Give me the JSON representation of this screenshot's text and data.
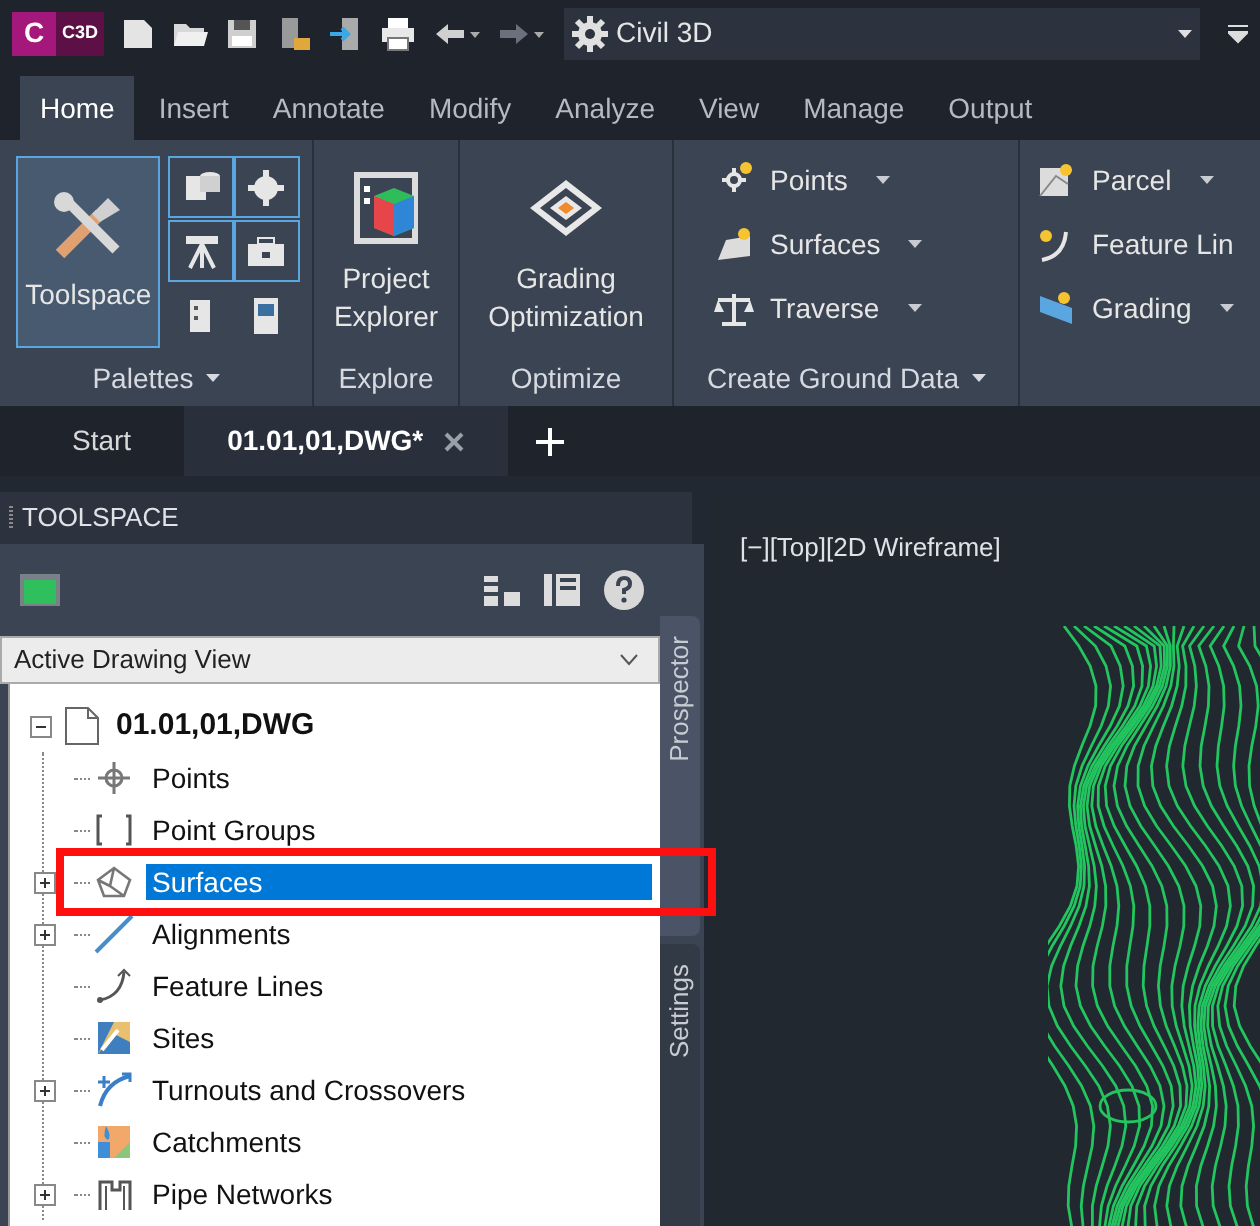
{
  "app": {
    "logo_letter": "C",
    "badge": "C3D",
    "workspace": "Civil 3D"
  },
  "ribbon_tabs": [
    {
      "label": "Home",
      "selected": true
    },
    {
      "label": "Insert",
      "selected": false
    },
    {
      "label": "Annotate",
      "selected": false
    },
    {
      "label": "Modify",
      "selected": false
    },
    {
      "label": "Analyze",
      "selected": false
    },
    {
      "label": "View",
      "selected": false
    },
    {
      "label": "Manage",
      "selected": false
    },
    {
      "label": "Output",
      "selected": false
    }
  ],
  "panels": [
    {
      "kind": "palettes",
      "title": "Palettes",
      "menu": true,
      "button": {
        "label": "Toolspace",
        "selected": true
      },
      "tools": [
        {
          "selected": true
        },
        {
          "selected": true
        },
        {
          "selected": true
        },
        {
          "selected": true
        },
        {
          "selected": false
        },
        {
          "selected": false
        }
      ]
    },
    {
      "kind": "big",
      "title": "Explore",
      "button": {
        "label": "Project Explorer"
      }
    },
    {
      "kind": "big",
      "title": "Optimize",
      "button": {
        "label": "Grading Optimization"
      }
    },
    {
      "kind": "list",
      "title": "Create Ground Data",
      "menu": true,
      "items": [
        {
          "label": "Points",
          "menu": true
        },
        {
          "label": "Surfaces",
          "menu": true
        },
        {
          "label": "Traverse",
          "menu": true
        }
      ]
    },
    {
      "kind": "list",
      "items": [
        {
          "label": "Parcel",
          "menu": true
        },
        {
          "label": "Feature Lin",
          "menu": false
        },
        {
          "label": "Grading",
          "menu": true
        }
      ]
    }
  ],
  "file_tabs": [
    {
      "label": "Start",
      "selected": false,
      "closable": false
    },
    {
      "label": "01.01,01,DWG*",
      "selected": true,
      "closable": true
    }
  ],
  "toolspace": {
    "title": "TOOLSPACE",
    "view": "Active Drawing View",
    "side_tabs": [
      {
        "label": "Prospector",
        "selected": true
      },
      {
        "label": "Settings",
        "selected": false
      }
    ],
    "tree": {
      "label": "01.01,01,DWG",
      "expanded": true,
      "selected": false,
      "children": [
        {
          "label": "Points",
          "selected": false
        },
        {
          "label": "Point Groups",
          "selected": false
        },
        {
          "label": "Surfaces",
          "expanded": false,
          "selected": true
        },
        {
          "label": "Alignments",
          "expanded": false,
          "selected": false
        },
        {
          "label": "Feature Lines",
          "selected": false
        },
        {
          "label": "Sites",
          "selected": false
        },
        {
          "label": "Turnouts and Crossovers",
          "expanded": false,
          "selected": false
        },
        {
          "label": "Catchments",
          "selected": false
        },
        {
          "label": "Pipe Networks",
          "expanded": false,
          "selected": false
        }
      ]
    }
  },
  "viewport": {
    "label": "[−][Top][2D Wireframe]"
  }
}
